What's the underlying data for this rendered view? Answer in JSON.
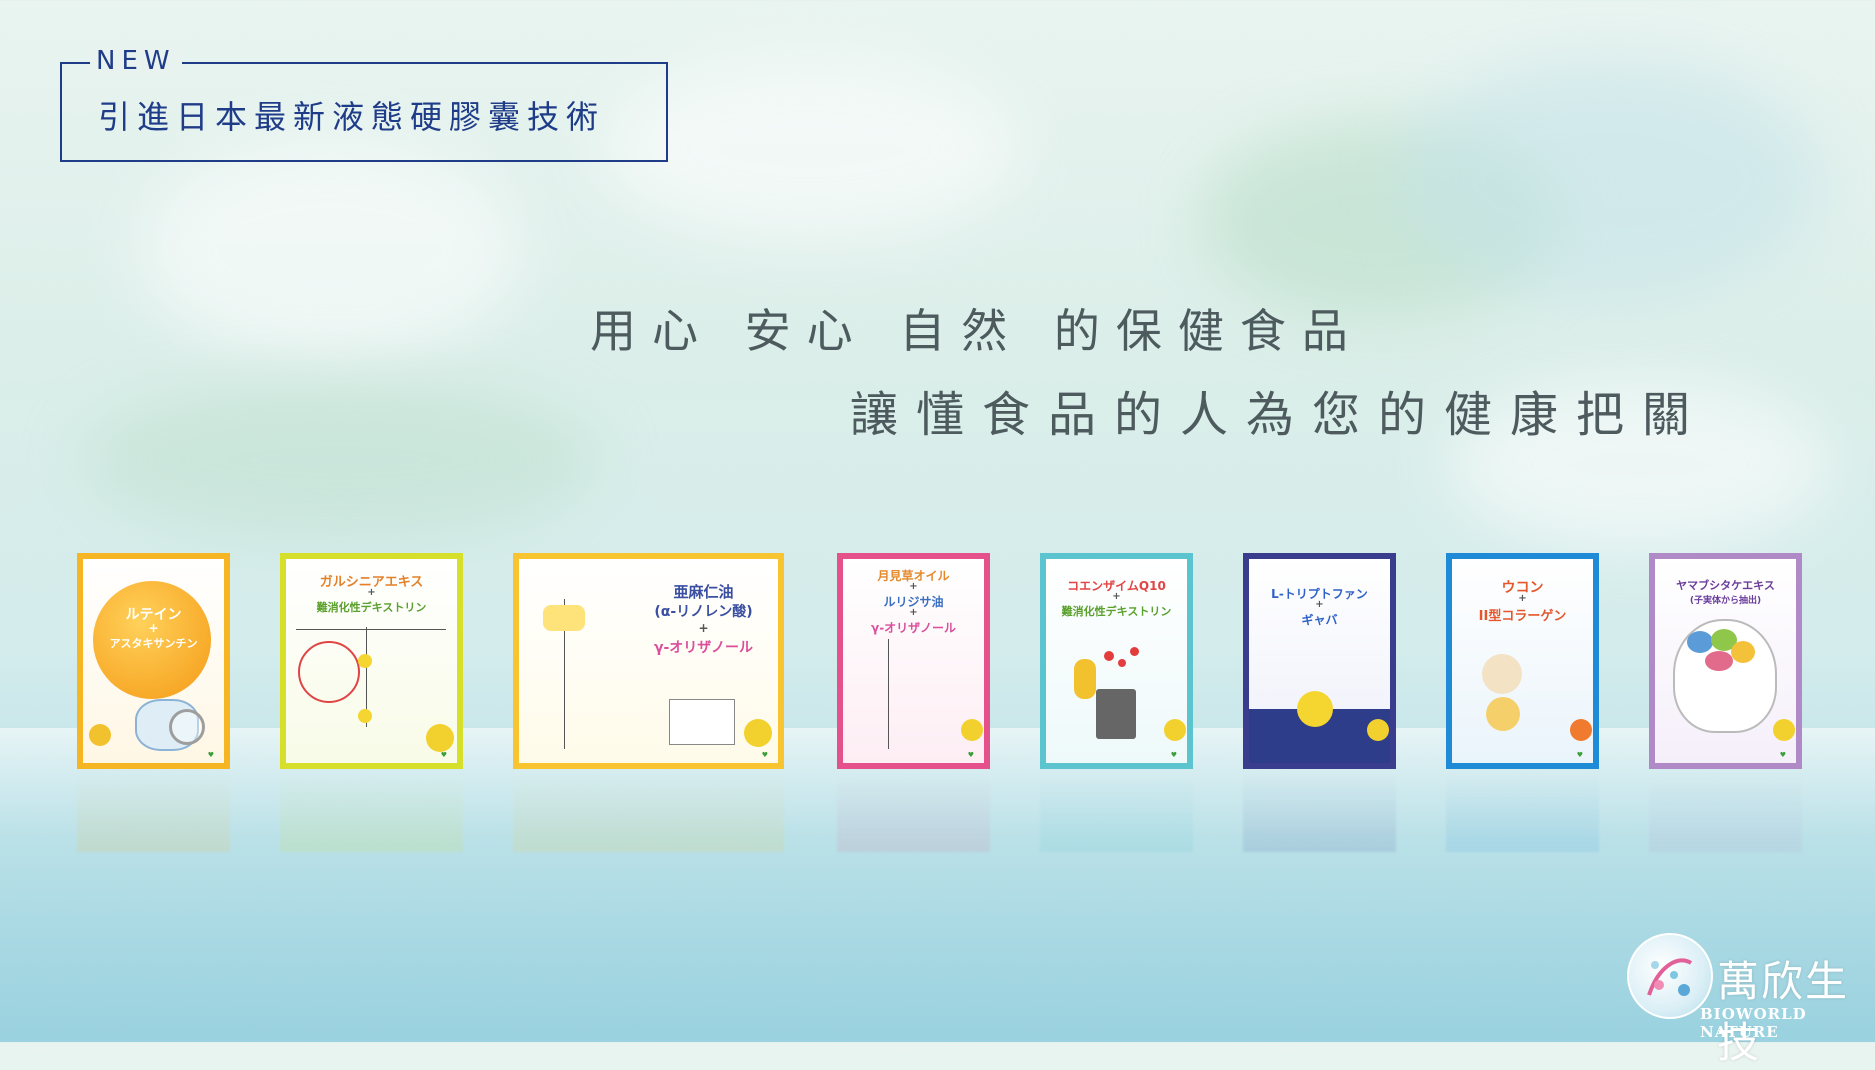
{
  "header": {
    "new_tag": "NEW",
    "title": "引進日本最新液態硬膠囊技術"
  },
  "slogan": {
    "line1": "用心 安心 自然 的保健食品",
    "line2": "讓懂食品的人為您的健康把關"
  },
  "products": [
    {
      "title": "ルテイン",
      "plus": "+",
      "subtitle": "アスタキサンチン",
      "border_color": "#f6b623"
    },
    {
      "title": "ガルシニアエキス",
      "plus": "+",
      "subtitle": "難消化性デキストリン",
      "border_color": "#d6e02a"
    },
    {
      "title": "亜麻仁油",
      "subtitle2": "(α-リノレン酸)",
      "plus": "+",
      "subtitle": "γ-オリザノール",
      "border_color": "#f8c531"
    },
    {
      "title": "月見草オイル",
      "plus": "+",
      "subtitle2": "ルリジサ油",
      "plus2": "+",
      "subtitle": "γ-オリザノール",
      "border_color": "#e5518a"
    },
    {
      "title": "コエンザイムQ10",
      "plus": "+",
      "subtitle": "難消化性デキストリン",
      "border_color": "#5cc4cf"
    },
    {
      "title": "L-トリプトファン",
      "plus": "+",
      "subtitle": "ギャバ",
      "border_color": "#3a3c8e"
    },
    {
      "title": "ウコン",
      "plus": "+",
      "subtitle": "II型コラーゲン",
      "border_color": "#1f8ad6"
    },
    {
      "title": "ヤマブシタケエキス",
      "subtitle": "(子実体から抽出)",
      "border_color": "#b08ac6"
    }
  ],
  "logo": {
    "name": "萬欣生技",
    "subtitle": "BIOWORLD NATURE"
  },
  "colors": {
    "header_blue": "#1f3c88",
    "slogan_gray": "#4d5a5e"
  }
}
